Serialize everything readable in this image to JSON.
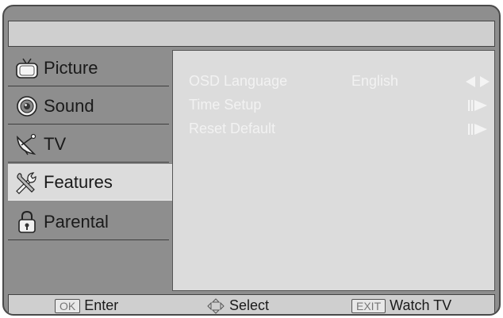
{
  "menu": {
    "items": [
      {
        "label": "Picture",
        "icon": "tv-icon"
      },
      {
        "label": "Sound",
        "icon": "speaker-icon"
      },
      {
        "label": "TV",
        "icon": "satellite-dish-icon"
      },
      {
        "label": "Features",
        "icon": "wrench-icon",
        "selected": true
      },
      {
        "label": "Parental",
        "icon": "lock-icon"
      }
    ]
  },
  "settings": [
    {
      "label": "OSD Language",
      "value": "English",
      "control": "left-right-arrows-icon"
    },
    {
      "label": "Time Setup",
      "value": "",
      "control": "enter-arrow-icon"
    },
    {
      "label": "Reset Default",
      "value": "",
      "control": "enter-arrow-icon"
    }
  ],
  "footer": {
    "enter_key": "OK",
    "enter_label": "Enter",
    "select_label": "Select",
    "exit_key": "EXIT",
    "exit_label": "Watch TV"
  },
  "colors": {
    "frame": "#8e8e8e",
    "panel": "#dcdcdc",
    "bar": "#cfcfcf",
    "setting_text": "#f2f2f2"
  }
}
